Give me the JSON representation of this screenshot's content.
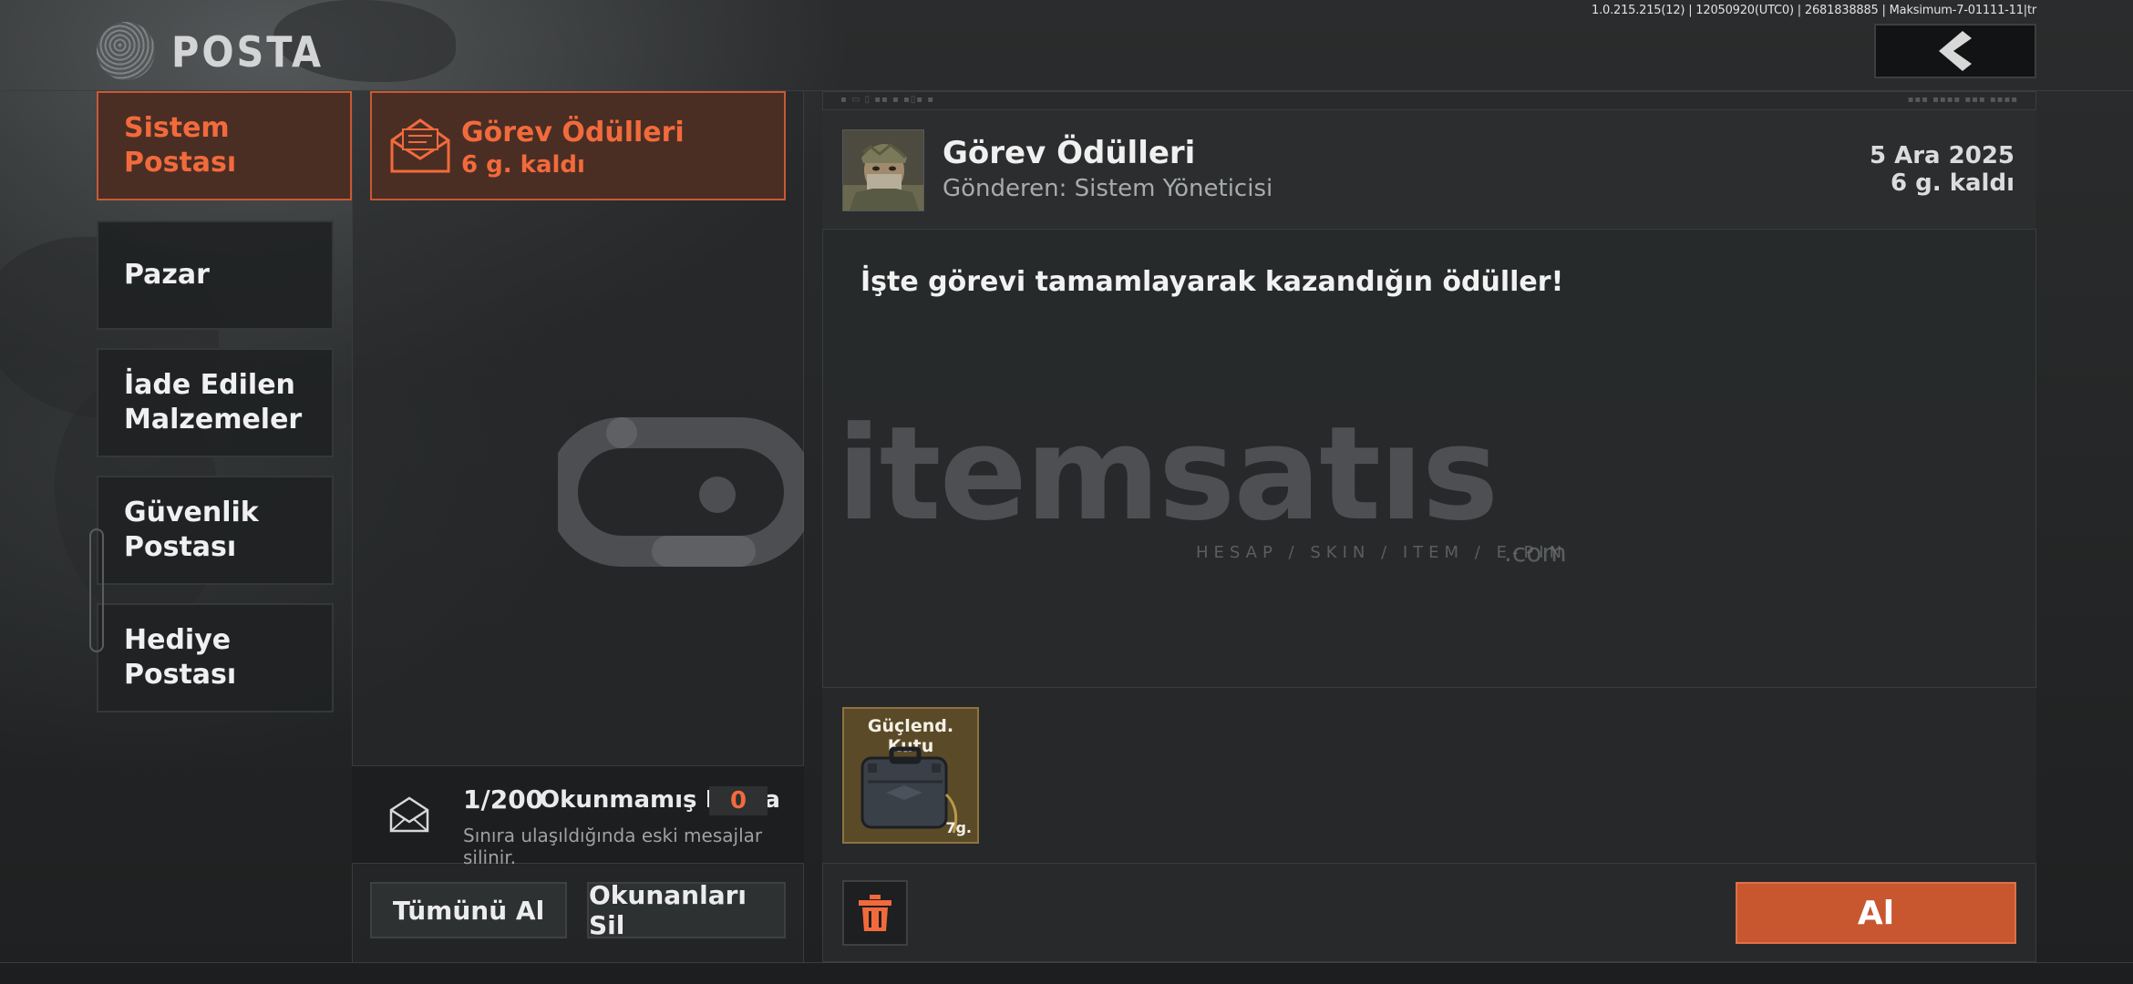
{
  "header": {
    "title": "POSTA",
    "version": "1.0.215.215(12) | 12050920(UTC0) | 2681838885 | Maksimum-7-01111-11|tr"
  },
  "sidebar": {
    "items": [
      {
        "label": "Sistem Postası",
        "active": true
      },
      {
        "label": "Pazar"
      },
      {
        "label": "İade Edilen Malzemeler"
      },
      {
        "label": "Güvenlik Postası"
      },
      {
        "label": "Hediye Postası"
      }
    ]
  },
  "mail_list": {
    "items": [
      {
        "title": "Görev Ödülleri",
        "remaining": "6 g. kaldı"
      }
    ],
    "count": "1/200",
    "unread_label": "Okunmamış Posta",
    "unread_count": "0",
    "limit_note": "Sınıra ulaşıldığında eski mesajlar silinir.",
    "claim_all_label": "Tümünü Al",
    "delete_read_label": "Okunanları Sil"
  },
  "detail": {
    "title": "Görev Ödülleri",
    "sender": "Gönderen: Sistem Yöneticisi",
    "date": "5 Ara 2025",
    "remaining": "6 g. kaldı",
    "body": "İşte görevi tamamlayarak kazandığın ödüller!",
    "rewards": [
      {
        "name": "Güçlend. Kutu",
        "duration": "7g.",
        "icon": "case-icon"
      }
    ],
    "claim_label": "Al"
  },
  "watermark": {
    "brand": "itemsatıs",
    "tagline": "HESAP / SKIN / ITEM / E-PIN",
    "suffix": ".com"
  },
  "colors": {
    "accent": "#f26a3c",
    "accent_bg": "#4a2e24",
    "claim_button": "#c8562e"
  }
}
